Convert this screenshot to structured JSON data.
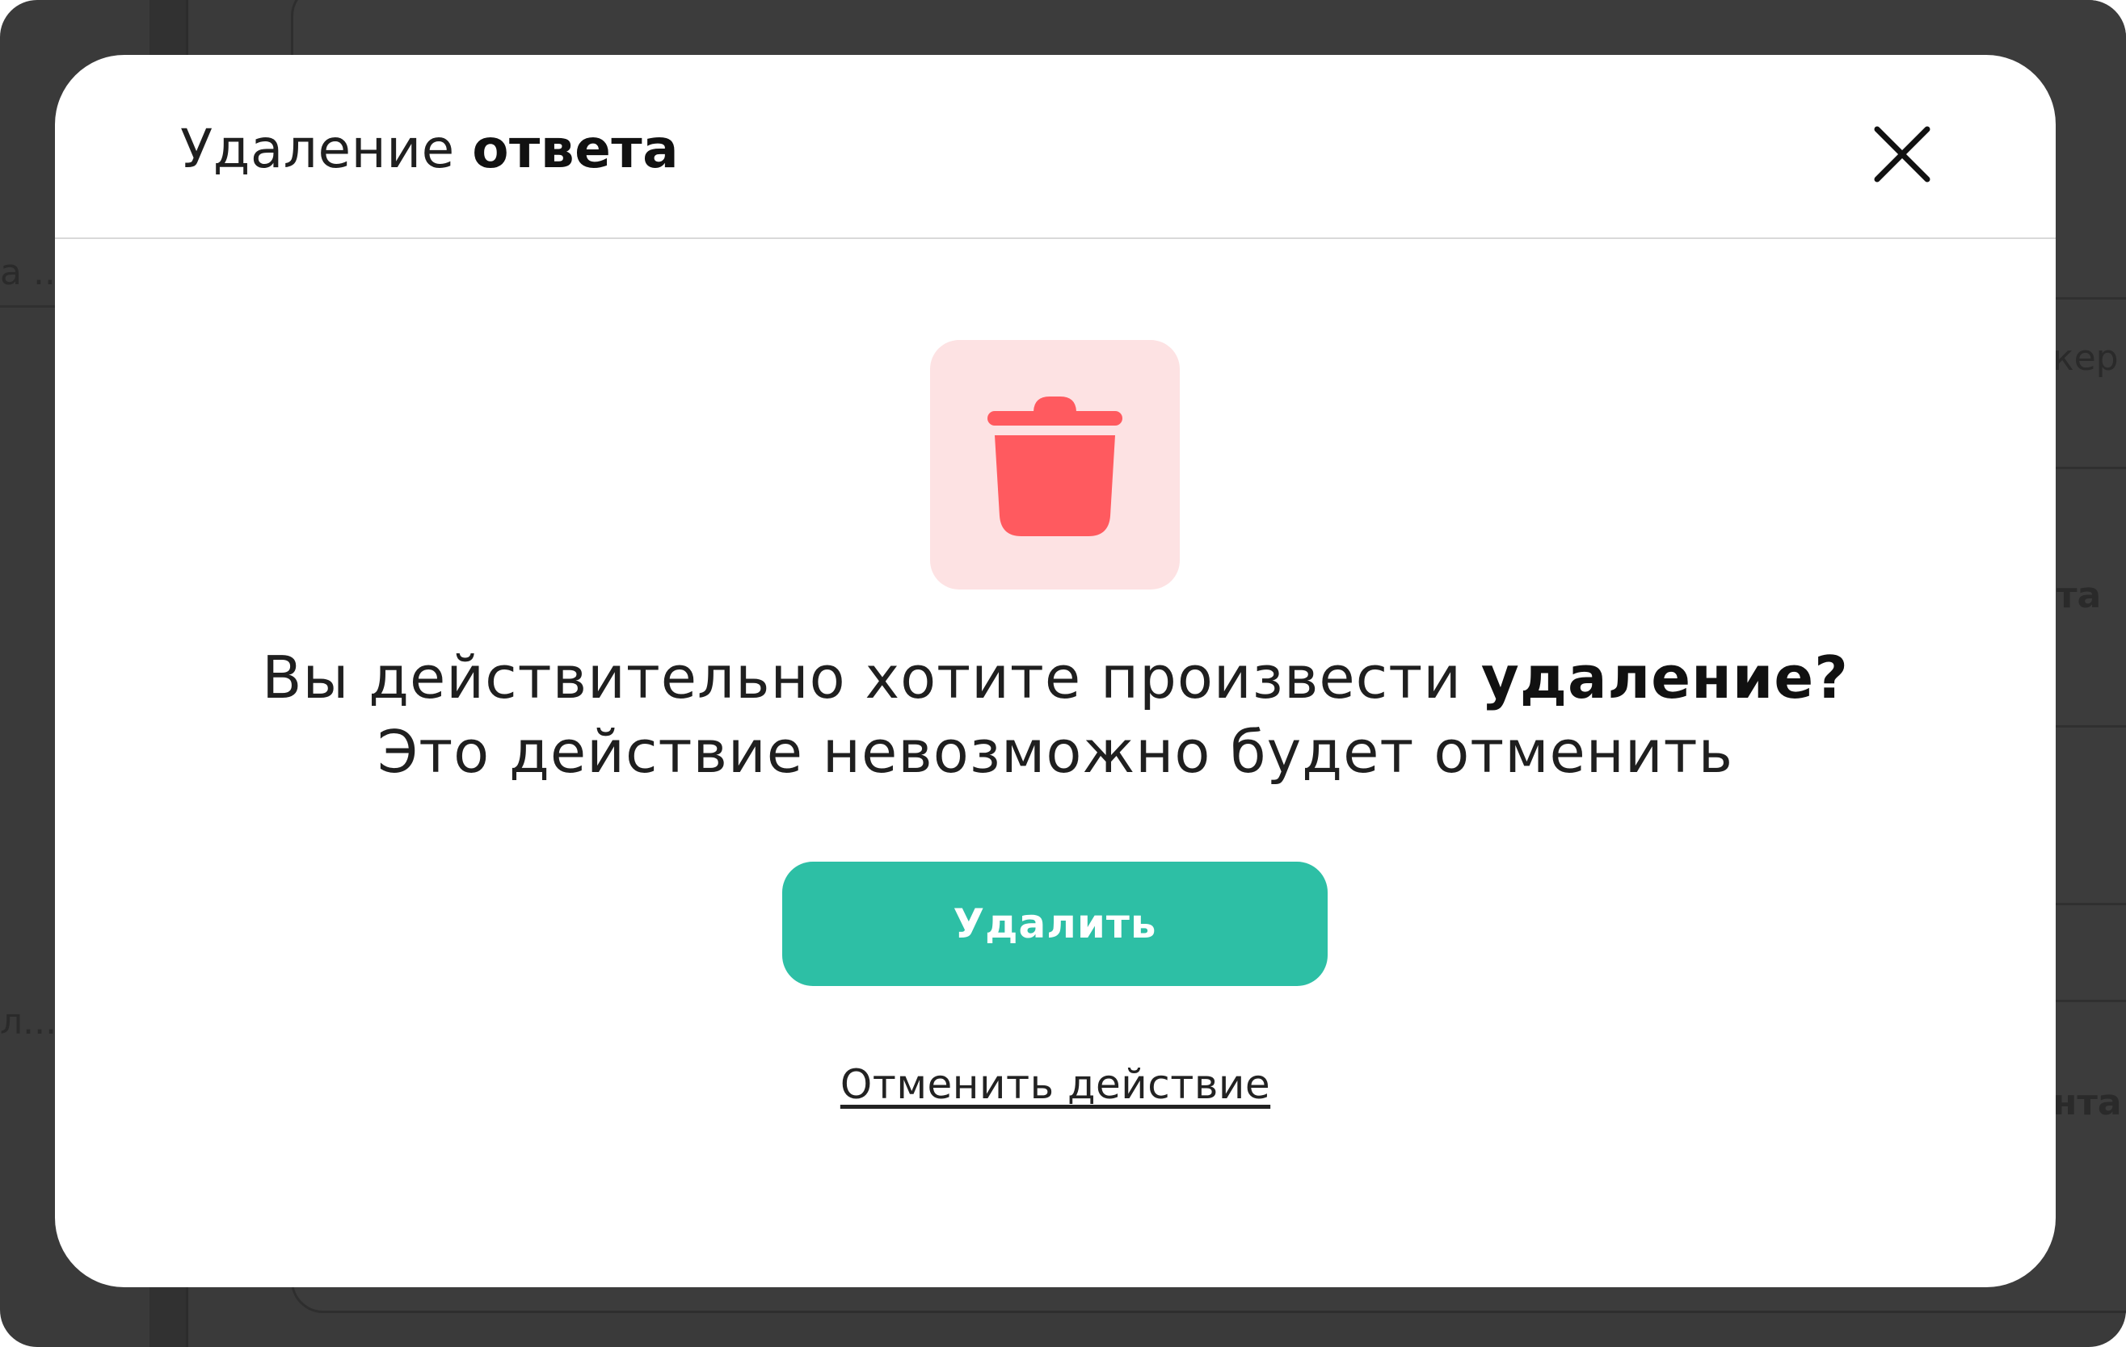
{
  "background": {
    "fragments": [
      "а ...",
      "кер",
      "та",
      "л...",
      "нта"
    ]
  },
  "modal": {
    "title_regular": "Удаление ",
    "title_bold": "ответа",
    "close_icon": "close-icon",
    "trash_icon": "trash-icon",
    "message_line1_regular": "Вы действительно хотите произвести ",
    "message_line1_bold": "удаление?",
    "message_line2": "Это действие невозможно будет отменить",
    "delete_label": "Удалить",
    "cancel_label": "Отменить действие"
  },
  "colors": {
    "accent": "#2dbfa5",
    "danger_icon": "#ff5a5f",
    "danger_bg": "#fde2e3",
    "backdrop": "#3a3a3a"
  }
}
